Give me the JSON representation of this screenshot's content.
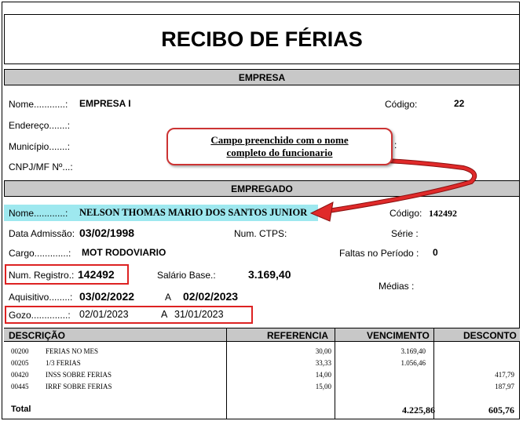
{
  "title": "RECIBO DE FÉRIAS",
  "empresa": {
    "header": "EMPRESA",
    "nome_label": "Nome............:",
    "nome_value": "EMPRESA I",
    "codigo_label": "Código:",
    "codigo_value": "22",
    "endereco_label": "Endereço.......:",
    "municipio_label": "Município.......:",
    "municipio_colon": ":",
    "cnpj_label": "CNPJ/MF Nº...:"
  },
  "callout": {
    "text": "Campo preenchido com o nome\ncompleto do funcionario"
  },
  "empregado": {
    "header": "EMPREGADO",
    "nome_label": "Nome............:",
    "nome_value": "NELSON THOMAS MARIO DOS SANTOS JUNIOR",
    "codigo_label": "Código:",
    "codigo_value": "142492",
    "admissao_label": "Data Admissão:",
    "admissao_value": "03/02/1998",
    "ctps_label": "Num. CTPS:",
    "serie_label": "Série :",
    "cargo_label": "Cargo.............:",
    "cargo_value": "MOT RODOVIARIO",
    "faltas_label": "Faltas no Período :",
    "faltas_value": "0",
    "registro_label": "Num. Registro.:",
    "registro_value": "142492",
    "salario_label": "Salário Base.:",
    "salario_value": "3.169,40",
    "medias_label": "Médias :",
    "aquisitivo_label": "Aquisitivo........:",
    "aquisitivo_inicio": "03/02/2022",
    "aquisitivo_a": "A",
    "aquisitivo_fim": "02/02/2023",
    "gozo_label": "Gozo..............:",
    "gozo_inicio": "02/01/2023",
    "gozo_a": "A",
    "gozo_fim": "31/01/2023"
  },
  "tabela": {
    "col_descricao": "DESCRIÇÃO",
    "col_referencia": "REFERENCIA",
    "col_vencimento": "VENCIMENTO",
    "col_desconto": "DESCONTO",
    "rows": [
      {
        "codigo": "00200",
        "descricao": "FERIAS NO MES",
        "referencia": "30,00",
        "vencimento": "3.169,40",
        "desconto": ""
      },
      {
        "codigo": "00205",
        "descricao": "1/3 FERIAS",
        "referencia": "33,33",
        "vencimento": "1.056,46",
        "desconto": ""
      },
      {
        "codigo": "00420",
        "descricao": "INSS SOBRE FERIAS",
        "referencia": "14,00",
        "vencimento": "",
        "desconto": "417,79"
      },
      {
        "codigo": "00445",
        "descricao": "IRRF SOBRE FERIAS",
        "referencia": "15,00",
        "vencimento": "",
        "desconto": "187,97"
      }
    ],
    "total_label": "Total",
    "total_vencimento": "4.225,86",
    "total_desconto": "605,76"
  },
  "colors": {
    "highlight": "#9ee8ef",
    "annotation_red": "#d22222",
    "section_gray": "#c8c8c8"
  }
}
